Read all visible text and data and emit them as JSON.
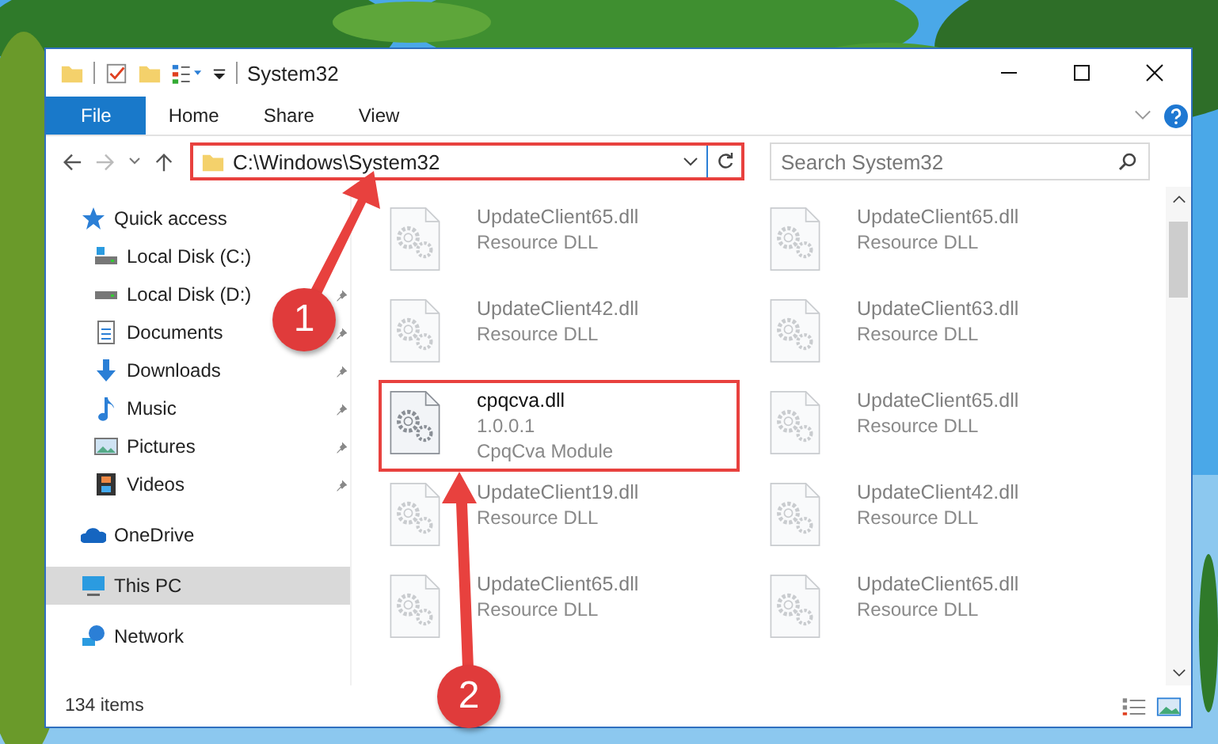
{
  "window": {
    "title": "System32"
  },
  "ribbon": {
    "tabs": [
      {
        "label": "File",
        "selected": true
      },
      {
        "label": "Home",
        "selected": false
      },
      {
        "label": "Share",
        "selected": false
      },
      {
        "label": "View",
        "selected": false
      }
    ]
  },
  "address_bar": {
    "path": "C:\\Windows\\System32",
    "highlighted": true
  },
  "search": {
    "placeholder": "Search System32"
  },
  "nav_pane": {
    "items": [
      {
        "label": "Quick access",
        "kind": "quick",
        "selected": false,
        "children": [
          {
            "label": "Local Disk (C:)",
            "kind": "diskc",
            "pinned": false,
            "selected": false
          },
          {
            "label": "Local Disk (D:)",
            "kind": "disk",
            "pinned": true,
            "selected": false
          },
          {
            "label": "Documents",
            "kind": "documents",
            "pinned": true,
            "selected": false
          },
          {
            "label": "Downloads",
            "kind": "downloads",
            "pinned": true,
            "selected": false
          },
          {
            "label": "Music",
            "kind": "music",
            "pinned": true,
            "selected": false
          },
          {
            "label": "Pictures",
            "kind": "pictures",
            "pinned": true,
            "selected": false
          },
          {
            "label": "Videos",
            "kind": "videos",
            "pinned": true,
            "selected": false
          }
        ]
      },
      {
        "label": "OneDrive",
        "kind": "onedrive",
        "selected": false
      },
      {
        "label": "This PC",
        "kind": "pc",
        "selected": true
      },
      {
        "label": "Network",
        "kind": "network",
        "selected": false
      }
    ]
  },
  "files": [
    {
      "name": "UpdateClient65.dll",
      "line_2": "Resource DLL",
      "blurred": true,
      "highlighted": false
    },
    {
      "name": "UpdateClient65.dll",
      "line_2": "Resource DLL",
      "blurred": true,
      "highlighted": false
    },
    {
      "name": "UpdateClient42.dll",
      "line_2": "Resource DLL",
      "blurred": true,
      "highlighted": false
    },
    {
      "name": "UpdateClient63.dll",
      "line_2": "Resource DLL",
      "blurred": true,
      "highlighted": false
    },
    {
      "name": "cpqcva.dll",
      "line_2": "1.0.0.1",
      "line_3": "CpqCva Module",
      "blurred": false,
      "highlighted": true
    },
    {
      "name": "UpdateClient65.dll",
      "line_2": "Resource DLL",
      "blurred": true,
      "highlighted": false
    },
    {
      "name": "UpdateClient19.dll",
      "line_2": "Resource DLL",
      "blurred": true,
      "highlighted": false
    },
    {
      "name": "UpdateClient42.dll",
      "line_2": "Resource DLL",
      "blurred": true,
      "highlighted": false
    },
    {
      "name": "UpdateClient65.dll",
      "line_2": "Resource DLL",
      "blurred": true,
      "highlighted": false
    },
    {
      "name": "UpdateClient65.dll",
      "line_2": "Resource DLL",
      "blurred": true,
      "highlighted": false
    }
  ],
  "status_bar": {
    "item_count": "134 items"
  },
  "annotations": [
    {
      "label": "1"
    },
    {
      "label": "2"
    }
  ]
}
